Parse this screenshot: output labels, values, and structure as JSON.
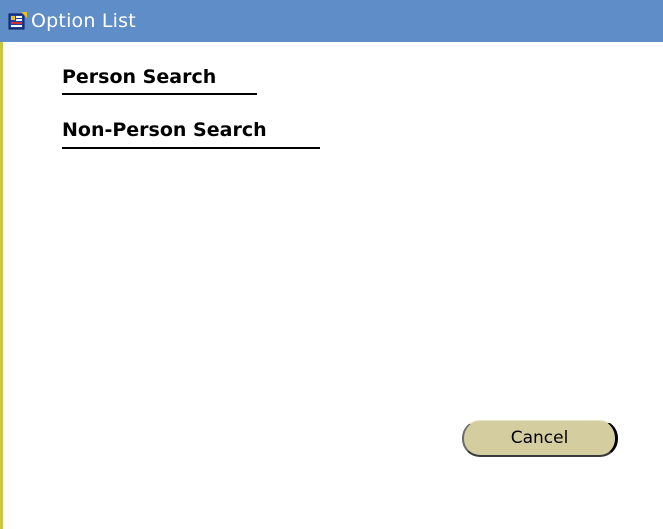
{
  "window": {
    "title": "Option List",
    "icon": "app-icon",
    "titlebar_color": "#5f8dc8",
    "edge_color": "#c8c840"
  },
  "options": [
    {
      "label": "Person Search"
    },
    {
      "label": "Non-Person Search"
    }
  ],
  "footer": {
    "cancel_label": "Cancel",
    "button_color": "#d4cda0"
  }
}
